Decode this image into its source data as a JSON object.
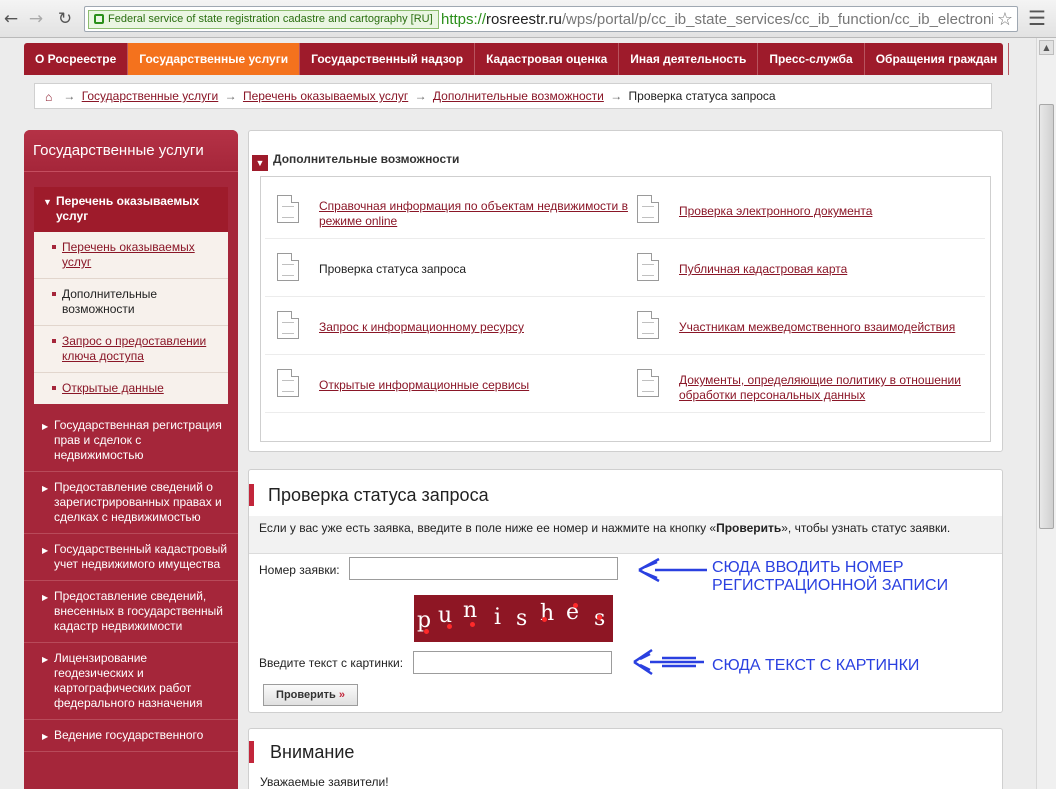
{
  "browser": {
    "ssl_label": "Federal service of state registration cadastre and cartography [RU]",
    "url_scheme": "https://",
    "url_host": "rosreestr.ru",
    "url_path": "/wps/portal/p/cc_ib_state_services/cc_ib_function/cc_ib_electronic_sts"
  },
  "topnav": {
    "items": [
      "О Росреестре",
      "Государственные услуги",
      "Государственный надзор",
      "Кадастровая оценка",
      "Иная деятельность",
      "Пресс-служба",
      "Обращения граждан"
    ],
    "active_index": 1
  },
  "breadcrumb": {
    "items": [
      "Государственные услуги",
      "Перечень оказываемых услуг",
      "Дополнительные возможности"
    ],
    "current": "Проверка статуса запроса"
  },
  "sidebar": {
    "title": "Государственные услуги",
    "section_title": "Перечень оказываемых услуг",
    "sub_items": [
      {
        "label": "Перечень оказываемых услуг",
        "link": true
      },
      {
        "label": "Дополнительные возможности",
        "link": false
      },
      {
        "label": "Запрос о предоставлении ключа доступа",
        "link": true
      },
      {
        "label": "Открытые данные",
        "link": true
      }
    ],
    "links": [
      "Государственная регистрация прав и сделок с недвижимостью",
      "Предоставление сведений о зарегистрированных правах и сделках с недвижимостью",
      "Государственный кадастровый учет недвижимого имущества",
      "Предоставление сведений, внесенных в государственный кадастр недвижимости",
      "Лицензирование геодезических и картографических работ федерального назначения",
      "Ведение государственного"
    ]
  },
  "extras": {
    "title": "Дополнительные возможности",
    "links": [
      {
        "label": "Справочная информация по объектам недвижимости в режиме online",
        "link": true
      },
      {
        "label": "Проверка электронного документа",
        "link": true
      },
      {
        "label": "Проверка статуса запроса",
        "link": false
      },
      {
        "label": "Публичная кадастровая карта",
        "link": true
      },
      {
        "label": "Запрос к информационному ресурсу",
        "link": true
      },
      {
        "label": "Участникам межведомственного взаимодействия",
        "link": true
      },
      {
        "label": "Открытые информационные сервисы",
        "link": true
      },
      {
        "label": "Документы, определяющие политику в отношении обработки персональных данных",
        "link": true
      }
    ]
  },
  "status_check": {
    "title": "Проверка статуса запроса",
    "desc_before": "Если у вас уже есть заявка, введите в поле ниже ее номер и нажмите на кнопку «",
    "desc_bold": "Проверить",
    "desc_after": "», чтобы узнать статус заявки.",
    "number_label": "Номер заявки:",
    "number_value": "",
    "captcha_text": "punishes",
    "captcha_label": "Введите текст с картинки:",
    "captcha_value": "",
    "submit_label": "Проверить",
    "submit_arrow": "»",
    "annotation_1_line1": "СЮДА ВВОДИТЬ НОМЕР",
    "annotation_1_line2": "РЕГИСТРАЦИОННОЙ ЗАПИСИ",
    "annotation_2": "СЮДА ТЕКСТ С КАРТИНКИ"
  },
  "attention": {
    "title": "Внимание",
    "text": "Уважаемые заявители!"
  },
  "colors": {
    "brand": "#9e1b2b",
    "accent": "#f4721d",
    "annotation": "#2a40e0"
  }
}
